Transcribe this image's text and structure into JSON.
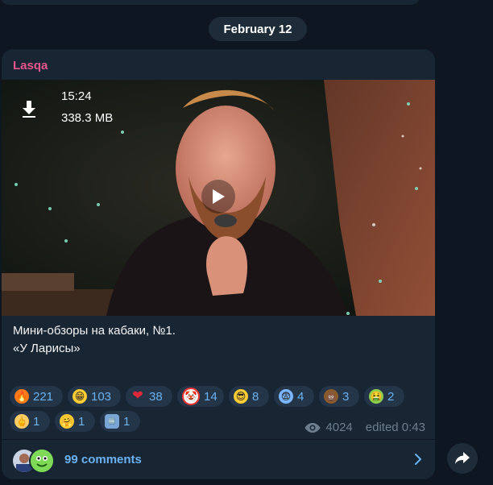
{
  "date_separator": "February 12",
  "post": {
    "author": "Lasqa",
    "video": {
      "duration": "15:24",
      "size": "338.3 MB"
    },
    "caption_lines": [
      "Мини-обзоры на кабаки, №1.",
      "«У Ларисы»"
    ],
    "reactions": [
      {
        "icon": "fire-emoji-icon",
        "emoji": "🔥",
        "count": "221"
      },
      {
        "icon": "grinning-face-emoji-icon",
        "emoji": "😁",
        "count": "103"
      },
      {
        "icon": "red-heart-emoji-icon",
        "emoji": "❤",
        "count": "38"
      },
      {
        "icon": "clown-face-emoji-icon",
        "emoji": "🤡",
        "count": "14"
      },
      {
        "icon": "sunglasses-face-emoji-icon",
        "emoji": "😎",
        "count": "8"
      },
      {
        "icon": "fearful-face-emoji-icon",
        "emoji": "😨",
        "count": "4"
      },
      {
        "icon": "pile-of-poo-emoji-icon",
        "emoji": "💩",
        "count": "3"
      },
      {
        "icon": "vomiting-face-emoji-icon",
        "emoji": "🤮",
        "count": "2"
      },
      {
        "icon": "middle-finger-emoji-icon",
        "emoji": "🖕",
        "count": "1"
      },
      {
        "icon": "hugging-face-emoji-icon",
        "emoji": "🤗",
        "count": "1"
      },
      {
        "icon": "cool-button-emoji-icon",
        "emoji": "🆒",
        "count": "1"
      }
    ],
    "views": "4024",
    "edited": "edited 0:43",
    "comments_label": "99 comments"
  },
  "colors": {
    "background": "#0e1621",
    "bubble": "#182533",
    "author": "#e9558d",
    "link": "#6ab2f2",
    "meta": "#6d7f8f"
  }
}
